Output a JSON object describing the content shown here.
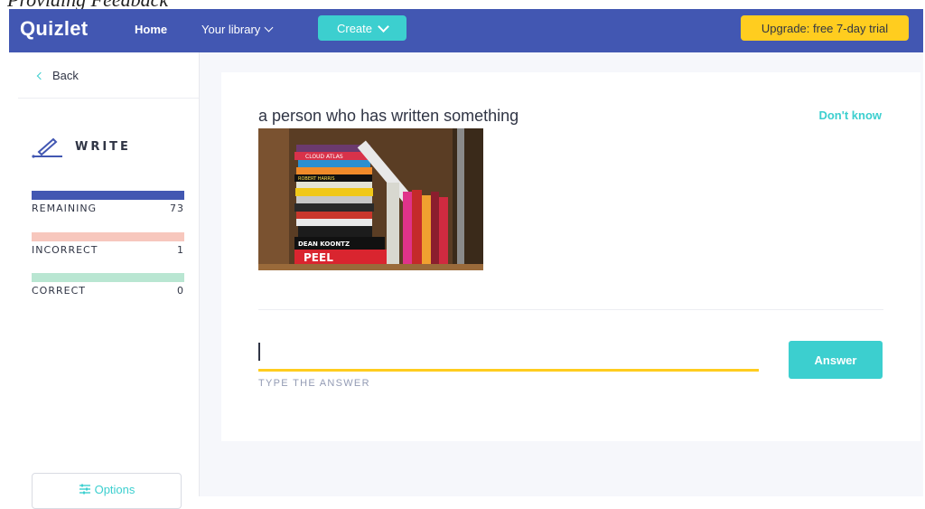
{
  "caption": "Providing Feedback",
  "header": {
    "logo": "Quizlet",
    "home": "Home",
    "library": "Your library",
    "create": "Create",
    "upgrade": "Upgrade: free 7-day trial"
  },
  "sidebar": {
    "back": "Back",
    "mode": "WRITE",
    "stats": [
      {
        "label": "REMAINING",
        "value": "73",
        "color": "#4257b2",
        "fill": 1.0
      },
      {
        "label": "INCORRECT",
        "value": "1",
        "color": "#f7c7bd",
        "fill": 1.0
      },
      {
        "label": "CORRECT",
        "value": "0",
        "color": "#b9e6d2",
        "fill": 1.0
      }
    ],
    "options": "Options"
  },
  "question": {
    "prompt": "a person who has written something",
    "dont_know": "Don't know",
    "input_hint": "TYPE THE ANSWER",
    "answer_button": "Answer",
    "input_value": ""
  },
  "colors": {
    "primary": "#4257b2",
    "accent": "#3ccfcf",
    "highlight": "#ffcd1f",
    "text": "#303545"
  },
  "image": {
    "book_spines": [
      "CLOUD ATLAS",
      "ROBERT HARRIS",
      "DEAN KOONTZ",
      "PEEL"
    ]
  }
}
